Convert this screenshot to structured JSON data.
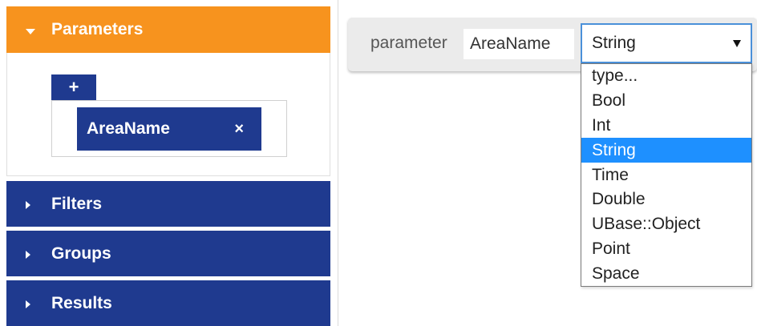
{
  "sidebar": {
    "parameters_label": "Parameters",
    "add_label": "+",
    "parameter_chip": "AreaName",
    "remove_label": "×",
    "filters_label": "Filters",
    "groups_label": "Groups",
    "results_label": "Results"
  },
  "editor": {
    "parameter_label": "parameter",
    "name_value": "AreaName",
    "type_selected": "String",
    "type_options": [
      "type...",
      "Bool",
      "Int",
      "String",
      "Time",
      "Double",
      "UBase::Object",
      "Point",
      "Space"
    ],
    "highlighted_option": "String"
  },
  "colors": {
    "accent_orange": "#f7931e",
    "navy": "#1f3a8f",
    "highlight_blue": "#1e90ff"
  }
}
